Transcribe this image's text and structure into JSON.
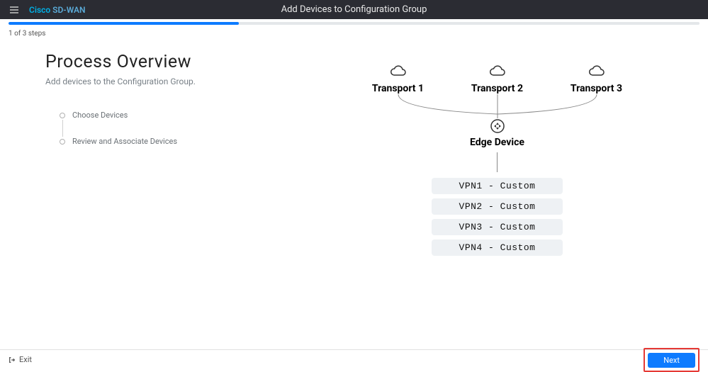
{
  "header": {
    "brand_cisco": "Cisco",
    "brand_sdwan": " SD-WAN",
    "title": "Add Devices to Configuration Group"
  },
  "progress": {
    "percent": 33.3,
    "text": "1 of 3 steps"
  },
  "overview": {
    "title": "Process Overview",
    "subtitle": "Add devices to the Configuration Group."
  },
  "timeline": {
    "items": [
      {
        "label": "Choose Devices"
      },
      {
        "label": "Review and Associate Devices"
      }
    ]
  },
  "diagram": {
    "transports": [
      {
        "label": "Transport 1"
      },
      {
        "label": "Transport 2"
      },
      {
        "label": "Transport 3"
      }
    ],
    "edge_label": "Edge Device",
    "vpns": [
      {
        "label": "VPN1 - Custom"
      },
      {
        "label": "VPN2 - Custom"
      },
      {
        "label": "VPN3 - Custom"
      },
      {
        "label": "VPN4 - Custom"
      }
    ]
  },
  "footer": {
    "exit": "Exit",
    "next": "Next"
  }
}
